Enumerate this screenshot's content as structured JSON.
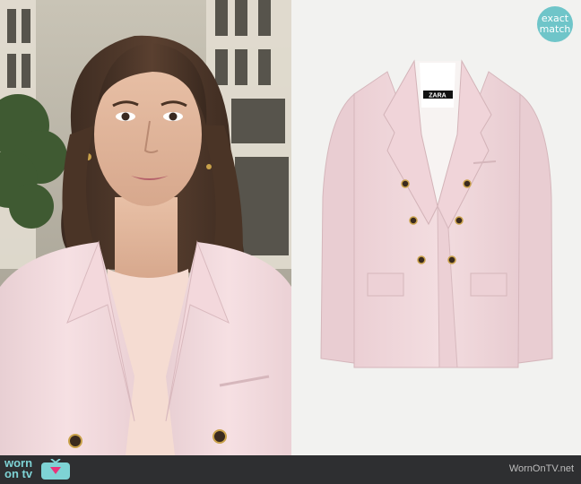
{
  "badge": {
    "line1": "exact",
    "line2": "match"
  },
  "product": {
    "brand_label": "ZARA"
  },
  "footer": {
    "brand_part1": "worn",
    "brand_part2": "on tv",
    "site": "WornOnTV.net"
  }
}
